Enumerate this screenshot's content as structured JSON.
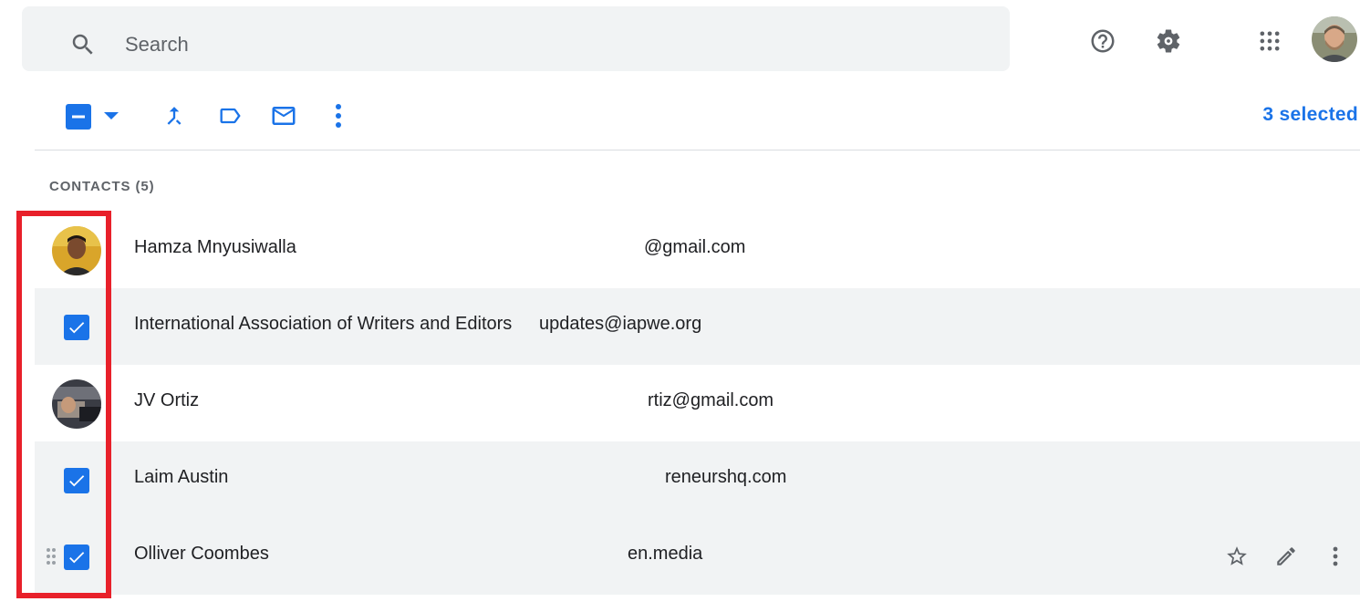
{
  "search": {
    "placeholder": "Search"
  },
  "header": {
    "help_icon": "help-circle-icon",
    "settings_icon": "gear-icon",
    "apps_icon": "apps-grid-icon"
  },
  "toolbar": {
    "selected_count": "3 selected"
  },
  "contacts": {
    "section_label": "CONTACTS (5)",
    "rows": [
      {
        "name": "Hamza Mnyusiwalla",
        "email": "@gmail.com",
        "selected": false
      },
      {
        "name": "International Association of Writers and Editors",
        "email": "updates@iapwe.org",
        "selected": true
      },
      {
        "name": "JV Ortiz",
        "email": "rtiz@gmail.com",
        "selected": false
      },
      {
        "name": "Laim Austin",
        "email": "reneurshq.com",
        "selected": true
      },
      {
        "name": "Olliver Coombes",
        "email": "en.media",
        "selected": true
      }
    ]
  },
  "colors": {
    "accent": "#1a73e8",
    "highlight": "#e8202a",
    "row_selected_bg": "#f1f3f4"
  }
}
